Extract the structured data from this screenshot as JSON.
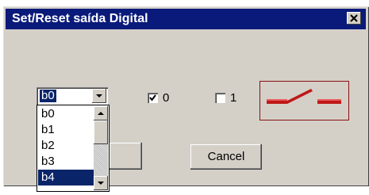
{
  "window": {
    "title": "Set/Reset saída Digital"
  },
  "combo": {
    "selected": "b0"
  },
  "list": {
    "items": [
      "b0",
      "b1",
      "b2",
      "b3",
      "b4"
    ],
    "highlighted_index": 4
  },
  "checkboxes": [
    {
      "label": "0",
      "checked": true
    },
    {
      "label": "1",
      "checked": false
    }
  ],
  "buttons": {
    "cancel": "Cancel"
  },
  "icons": {
    "close": "close-icon",
    "switch": "switch-icon"
  },
  "colors": {
    "titlebar": "#0a1a7a",
    "selection": "#0a246a",
    "switch": "#c01818"
  }
}
